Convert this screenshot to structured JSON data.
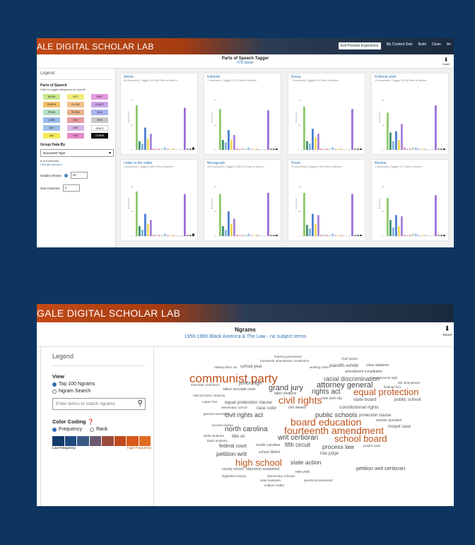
{
  "shot1": {
    "brand": "ALE DIGITAL SCHOLAR LAB",
    "nav": [
      "Exit Preview Experience",
      "My Content Sets",
      "Build",
      "Clean",
      "An"
    ],
    "title": "Parts of Speech Tagger",
    "subtitle": "H B Stowe",
    "download_label": "Downl",
    "legend_title": "Legend",
    "pos_title": "Parts of Speech",
    "pos_hint": "Click to toggle categories on and off",
    "pos_tags": [
      {
        "label": "NOUN",
        "color": "#c6e88a"
      },
      {
        "label": "INTJ",
        "color": "#f3ec7c"
      },
      {
        "label": "PART",
        "color": "#e89ae0"
      },
      {
        "label": "PROPN",
        "color": "#f0c16a"
      },
      {
        "label": "CCONJ",
        "color": "#f5c18a"
      },
      {
        "label": "PUNCT",
        "color": "#c9a5e8"
      },
      {
        "label": "PRON",
        "color": "#b3dfc2"
      },
      {
        "label": "SCONJ",
        "color": "#e7b28a"
      },
      {
        "label": "SUM",
        "color": "#a9b3ef"
      },
      {
        "label": "VERB",
        "color": "#9bbcec"
      },
      {
        "label": "DET",
        "color": "#e79aa2"
      },
      {
        "label": "SYM",
        "color": "#c9c9c9"
      },
      {
        "label": "ADV",
        "color": "#9ec1e6"
      },
      {
        "label": "ADP",
        "color": "#d6b5e3"
      },
      {
        "label": "SPACE",
        "color": "#ffffff"
      },
      {
        "label": "ADJ",
        "color": "#f3ea5a"
      },
      {
        "label": "AUX",
        "color": "#e58ac8"
      },
      {
        "label": "OTHER",
        "color": "#111111"
      }
    ],
    "group_title": "Group Data By",
    "group_value": "Document Type",
    "selected_text": "8 of 8 selected",
    "change_selection": "Change selection",
    "graphs_shown_label": "Graphs Shown",
    "graphs_shown_value": "10",
    "grid_columns_label": "Grid Columns",
    "grid_columns_value": "4",
    "panels": [
      {
        "title": "Article",
        "sub": "86 documents | Tagged 100,968 Parts of Speech",
        "ylabel": "Percent (%)",
        "yticks": [
          "40",
          "20",
          "0"
        ]
      },
      {
        "title": "Editorial",
        "sub": "7 documents | Tagged 3,171 Parts of Speech",
        "ylabel": "Percent (%)",
        "yticks": [
          "40",
          "20",
          "0"
        ]
      },
      {
        "title": "Essay",
        "sub": "7 documents | Tagged 511 Parts of Speech",
        "ylabel": "Percent (%)",
        "yticks": [
          "40",
          "20",
          "0"
        ]
      },
      {
        "title": "Fictional work",
        "sub": "19 documents | Tagged 35,196 Parts of Speech",
        "ylabel": "Percent (%)",
        "yticks": [
          "40",
          "20",
          "0"
        ]
      },
      {
        "title": "Letter to the editor",
        "sub": "4 documents | Tagged 2,581 Parts of Speech",
        "ylabel": "Percent (%)",
        "yticks": [
          "40",
          "20",
          "0"
        ]
      },
      {
        "title": "Monograph",
        "sub": "107 documents | Tagged 3,595,120 Parts of Speech",
        "ylabel": "Percent (%)",
        "yticks": [
          "40",
          "20",
          "0"
        ]
      },
      {
        "title": "Poem",
        "sub": "29 documents | Tagged 5,208 Parts of Speech",
        "ylabel": "Percent (%)",
        "yticks": [
          "40",
          "20",
          "0"
        ]
      },
      {
        "title": "Review",
        "sub": "1 documents | Tagged 170 Parts of Speech",
        "ylabel": "Percent (%)",
        "yticks": [
          "40",
          "20",
          "0"
        ]
      }
    ]
  },
  "chart_data": [
    {
      "type": "bar",
      "title": "Article",
      "ylabel": "Percent (%)",
      "ylim": [
        0,
        40
      ],
      "values": [
        36,
        7,
        5,
        18,
        9,
        13,
        1,
        1,
        1,
        1,
        2,
        1,
        1,
        1,
        0,
        0,
        0,
        34,
        1,
        1,
        2
      ]
    },
    {
      "type": "bar",
      "title": "Editorial",
      "ylabel": "Percent (%)",
      "ylim": [
        0,
        40
      ],
      "values": [
        33,
        8,
        6,
        16,
        8,
        12,
        1,
        1,
        1,
        1,
        2,
        1,
        1,
        1,
        0,
        0,
        0,
        32,
        1,
        1,
        1
      ]
    },
    {
      "type": "bar",
      "title": "Essay",
      "ylabel": "Percent (%)",
      "ylim": [
        0,
        40
      ],
      "values": [
        35,
        7,
        5,
        17,
        10,
        13,
        1,
        1,
        1,
        1,
        2,
        1,
        1,
        1,
        0,
        0,
        0,
        33,
        1,
        1,
        1
      ]
    },
    {
      "type": "bar",
      "title": "Fictional work",
      "ylabel": "Percent (%)",
      "ylim": [
        0,
        40
      ],
      "values": [
        30,
        14,
        7,
        15,
        8,
        21,
        2,
        1,
        1,
        2,
        2,
        1,
        1,
        1,
        0,
        0,
        0,
        36,
        1,
        1,
        1
      ]
    },
    {
      "type": "bar",
      "title": "Letter to the editor",
      "ylabel": "Percent (%)",
      "ylim": [
        0,
        40
      ],
      "values": [
        36,
        8,
        5,
        18,
        10,
        13,
        1,
        1,
        1,
        1,
        2,
        1,
        1,
        1,
        0,
        0,
        0,
        34,
        1,
        1,
        2
      ]
    },
    {
      "type": "bar",
      "title": "Monograph",
      "ylabel": "Percent (%)",
      "ylim": [
        0,
        40
      ],
      "values": [
        34,
        8,
        5,
        20,
        10,
        14,
        1,
        1,
        1,
        1,
        2,
        1,
        1,
        1,
        0,
        0,
        0,
        35,
        1,
        1,
        1
      ]
    },
    {
      "type": "bar",
      "title": "Poem",
      "ylabel": "Percent (%)",
      "ylim": [
        0,
        40
      ],
      "values": [
        35,
        9,
        6,
        18,
        10,
        17,
        1,
        1,
        1,
        1,
        2,
        1,
        1,
        1,
        0,
        0,
        0,
        34,
        1,
        1,
        1
      ]
    },
    {
      "type": "bar",
      "title": "Review",
      "ylabel": "Percent (%)",
      "ylim": [
        0,
        40
      ],
      "values": [
        31,
        13,
        7,
        17,
        8,
        16,
        1,
        1,
        1,
        2,
        2,
        1,
        1,
        1,
        0,
        0,
        0,
        33,
        1,
        1,
        1
      ]
    }
  ],
  "shot2": {
    "brand": "GALE DIGITAL SCHOLAR LAB",
    "title": "Ngrams",
    "subtitle": "1950-1980 Black America & The Law - no subject terms",
    "download_label": "Downl",
    "legend_title": "Legend",
    "view_title": "View",
    "view_options": [
      "Top 100 Ngrams",
      "Ngram Search"
    ],
    "search_placeholder": "Enter terms to match ngrams",
    "color_coding_title": "Color Coding",
    "color_options": [
      "Frequency",
      "Rank"
    ],
    "scale_colors": [
      "#123a6b",
      "#1f4a7f",
      "#3a5a86",
      "#6a5a70",
      "#9a4a3a",
      "#bd4a1c",
      "#d8571a",
      "#e26b25"
    ],
    "scale_low": "Low Frequency",
    "scale_high": "High Frequency",
    "words": [
      {
        "t": "federal government",
        "c": "#555"
      },
      {
        "t": "fourteenth amendment constitution",
        "c": "#555"
      },
      {
        "t": "chief justice",
        "c": "#555"
      },
      {
        "t": "railway labor act",
        "c": "#555"
      },
      {
        "t": "school year",
        "c": "#555"
      },
      {
        "t": "working class",
        "c": "#555"
      },
      {
        "t": "plaintiffs exhibit",
        "c": "#555"
      },
      {
        "t": "class alabama",
        "c": "#555"
      },
      {
        "t": "amendment constitution",
        "c": "#555"
      },
      {
        "t": "communist party",
        "c": "#c0521c"
      },
      {
        "t": "racial discrimination",
        "c": "#555"
      },
      {
        "t": "constitutional right",
        "c": "#555"
      },
      {
        "t": "interstate commerce",
        "c": "#555"
      },
      {
        "t": "junior high",
        "c": "#555"
      },
      {
        "t": "attorney general",
        "c": "#444"
      },
      {
        "t": "5th amendment",
        "c": "#555"
      },
      {
        "t": "labor act",
        "c": "#555"
      },
      {
        "t": "state court",
        "c": "#555"
      },
      {
        "t": "grand jury",
        "c": "#444"
      },
      {
        "t": "findings fact",
        "c": "#555"
      },
      {
        "t": "rights act",
        "c": "#444"
      },
      {
        "t": "equal protection",
        "c": "#c0521c"
      },
      {
        "t": "national labor relations",
        "c": "#555"
      },
      {
        "t": "labor relations",
        "c": "#555"
      },
      {
        "t": "civil rights",
        "c": "#c0521c"
      },
      {
        "t": "new york city",
        "c": "#555"
      },
      {
        "t": "state board",
        "c": "#555"
      },
      {
        "t": "public school",
        "c": "#555"
      },
      {
        "t": "matter fact",
        "c": "#555"
      },
      {
        "t": "equal protection clause",
        "c": "#555"
      },
      {
        "t": "elementary school",
        "c": "#555"
      },
      {
        "t": "race color",
        "c": "#555"
      },
      {
        "t": "cert denied",
        "c": "#555"
      },
      {
        "t": "constitutional rights",
        "c": "#555"
      },
      {
        "t": "general assembly",
        "c": "#555"
      },
      {
        "t": "civil rights act",
        "c": "#444"
      },
      {
        "t": "public schools",
        "c": "#444"
      },
      {
        "t": "protection clause",
        "c": "#555"
      },
      {
        "t": "answer question",
        "c": "#555"
      },
      {
        "t": "board education",
        "c": "#c0521c"
      },
      {
        "t": "instant case",
        "c": "#555"
      },
      {
        "t": "process clause",
        "c": "#555"
      },
      {
        "t": "north carolina",
        "c": "#444"
      },
      {
        "t": "fourteenth amendment",
        "c": "#c0521c"
      },
      {
        "t": "white students",
        "c": "#555"
      },
      {
        "t": "title vii",
        "c": "#555"
      },
      {
        "t": "writ certiorari",
        "c": "#444"
      },
      {
        "t": "school board",
        "c": "#c0521c"
      },
      {
        "t": "black students",
        "c": "#555"
      },
      {
        "t": "federal court",
        "c": "#444"
      },
      {
        "t": "south carolina",
        "c": "#555"
      },
      {
        "t": "fifth circuit",
        "c": "#444"
      },
      {
        "t": "process law",
        "c": "#444"
      },
      {
        "t": "project case",
        "c": "#555"
      },
      {
        "t": "petition writ",
        "c": "#444"
      },
      {
        "t": "school district",
        "c": "#555"
      },
      {
        "t": "trial judge",
        "c": "#555"
      },
      {
        "t": "high school",
        "c": "#c0521c"
      },
      {
        "t": "state action",
        "c": "#444"
      },
      {
        "t": "county school",
        "c": "#555"
      },
      {
        "t": "objection sustained",
        "c": "#555"
      },
      {
        "t": "petition writ certiorari",
        "c": "#444"
      },
      {
        "t": "new york",
        "c": "#555"
      },
      {
        "t": "legislative history",
        "c": "#555"
      },
      {
        "t": "elementary schools",
        "c": "#555"
      },
      {
        "t": "state louisiana",
        "c": "#555"
      },
      {
        "t": "questions presented",
        "c": "#555"
      },
      {
        "t": "subject matter",
        "c": "#555"
      }
    ]
  }
}
